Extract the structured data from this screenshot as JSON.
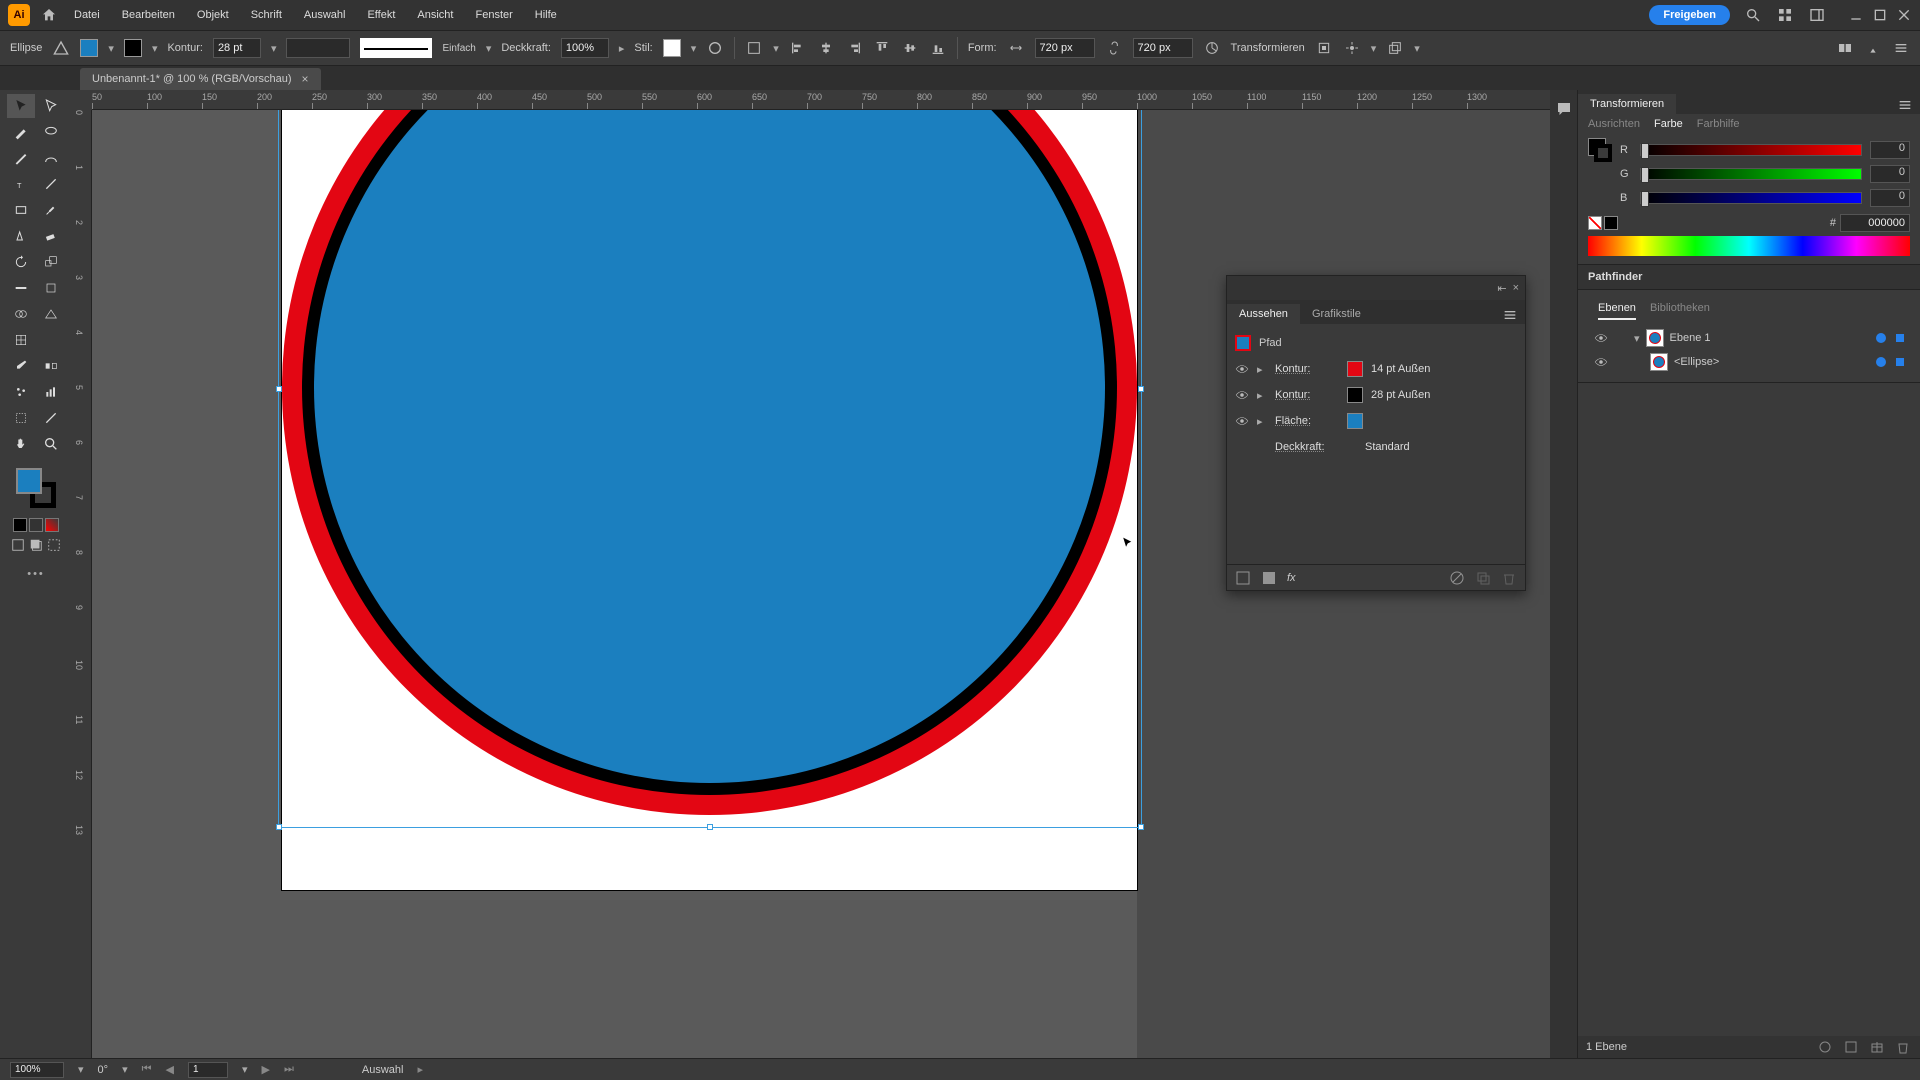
{
  "app": {
    "logo_letter": "Ai"
  },
  "menu": {
    "items": [
      "Datei",
      "Bearbeiten",
      "Objekt",
      "Schrift",
      "Auswahl",
      "Effekt",
      "Ansicht",
      "Fenster",
      "Hilfe"
    ]
  },
  "share_label": "Freigeben",
  "ctrl": {
    "shape": "Ellipse",
    "stroke_label": "Kontur:",
    "stroke_val": "28 pt",
    "stroke_style_label": "Einfach",
    "opacity_label": "Deckkraft:",
    "opacity_val": "100%",
    "style_label": "Stil:",
    "shape_label": "Form:",
    "w_val": "720 px",
    "h_val": "720 px",
    "transform_label": "Transformieren"
  },
  "doc": {
    "tab": "Unbenannt-1* @ 100 % (RGB/Vorschau)"
  },
  "ruler_h": [
    "50",
    "100",
    "150",
    "200",
    "250",
    "300",
    "350",
    "400",
    "450",
    "500",
    "550",
    "600",
    "650",
    "700",
    "750",
    "800",
    "850",
    "900",
    "950",
    "1000",
    "1050",
    "1100",
    "1150",
    "1200",
    "1250",
    "1300"
  ],
  "ruler_v": [
    "0",
    "1",
    "2",
    "3",
    "4",
    "5",
    "6",
    "7",
    "8",
    "9",
    "10",
    "11",
    "12",
    "13"
  ],
  "appearance": {
    "tab1": "Aussehen",
    "tab2": "Grafikstile",
    "path": "Pfad",
    "stroke1_label": "Kontur:",
    "stroke1_val": "14 pt  Außen",
    "stroke2_label": "Kontur:",
    "stroke2_val": "28 pt  Außen",
    "fill_label": "Fläche:",
    "opacity_label": "Deckkraft:",
    "opacity_val": "Standard",
    "fx": "fx"
  },
  "right": {
    "transform": "Transformieren",
    "align": "Ausrichten",
    "color": "Farbe",
    "colorhelp": "Farbhilfe",
    "r": "R",
    "g": "G",
    "b": "B",
    "r_val": "0",
    "g_val": "0",
    "b_val": "0",
    "hex_sym": "#",
    "hex": "000000",
    "pathfinder": "Pathfinder",
    "layers": "Ebenen",
    "libraries": "Bibliotheken",
    "layer1": "Ebene 1",
    "ellipse": "<Ellipse>",
    "foot": "1 Ebene"
  },
  "status": {
    "zoom": "100%",
    "angle": "0°",
    "page": "1",
    "tool": "Auswahl"
  },
  "colors": {
    "fill": "#1b7fbf",
    "stroke_outer": "#e30613",
    "stroke_inner": "#000000"
  }
}
